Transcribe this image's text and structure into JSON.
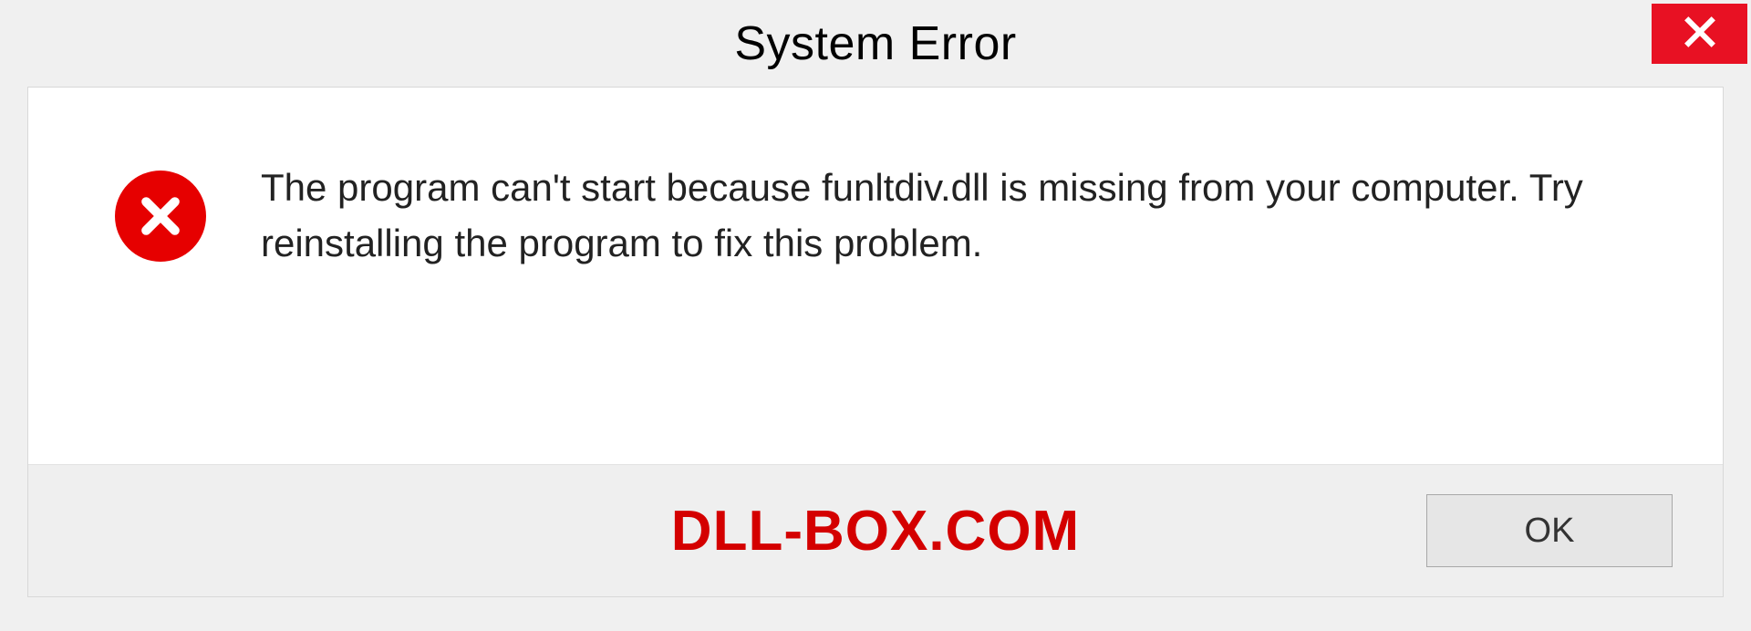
{
  "dialog": {
    "title": "System Error",
    "message": "The program can't start because funltdiv.dll is missing from your computer. Try reinstalling the program to fix this problem.",
    "ok_label": "OK"
  },
  "watermark": "DLL-BOX.COM",
  "colors": {
    "close_bg": "#e81123",
    "error_icon": "#e60000",
    "watermark": "#d40000"
  }
}
